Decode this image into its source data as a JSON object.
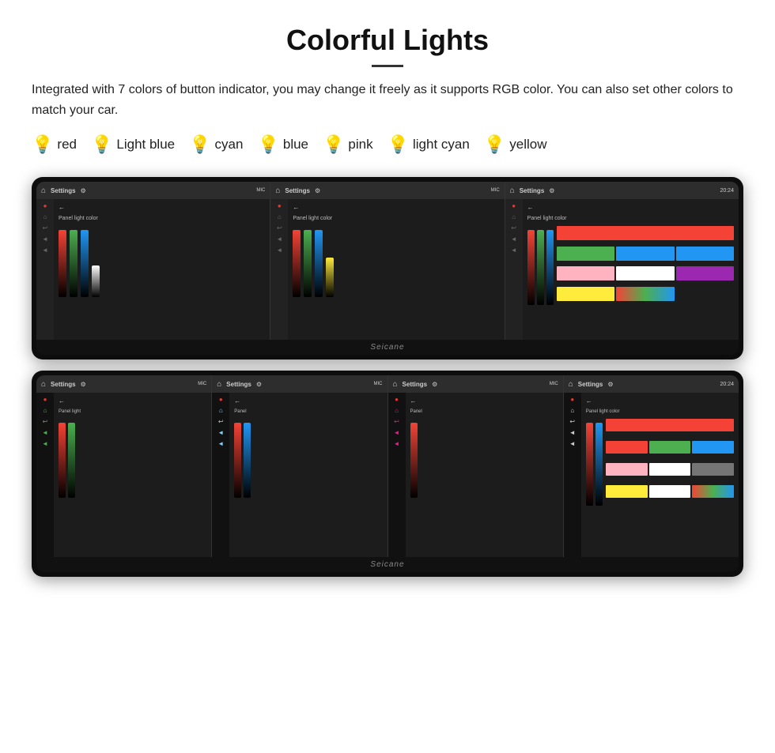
{
  "header": {
    "title": "Colorful Lights",
    "description": "Integrated with 7 colors of button indicator, you may change it freely as it supports RGB color. You can also set other colors to match your car."
  },
  "colors": [
    {
      "name": "red",
      "color": "#f44336",
      "bulb": "🔴"
    },
    {
      "name": "Light blue",
      "color": "#81d4fa",
      "bulb": "💡"
    },
    {
      "name": "cyan",
      "color": "#00bcd4",
      "bulb": "💡"
    },
    {
      "name": "blue",
      "color": "#2196f3",
      "bulb": "💡"
    },
    {
      "name": "pink",
      "color": "#e91e8c",
      "bulb": "💡"
    },
    {
      "name": "light cyan",
      "color": "#b2ebf2",
      "bulb": "💡"
    },
    {
      "name": "yellow",
      "color": "#ffeb3b",
      "bulb": "💡"
    }
  ],
  "screens": {
    "top_row": {
      "label": "Settings",
      "panel_label": "Panel light color",
      "watermark": "Seicane"
    },
    "bottom_row": {
      "label": "Settings",
      "panel_label": "Panel light",
      "watermark": "Seicane"
    }
  },
  "bulb_colors": {
    "red": "#f44336",
    "light_blue": "#81d4fa",
    "cyan": "#00bcd4",
    "blue": "#2196f3",
    "pink": "#e91e8c",
    "light_cyan": "#b2ebf2",
    "yellow": "#ffeb3b"
  }
}
